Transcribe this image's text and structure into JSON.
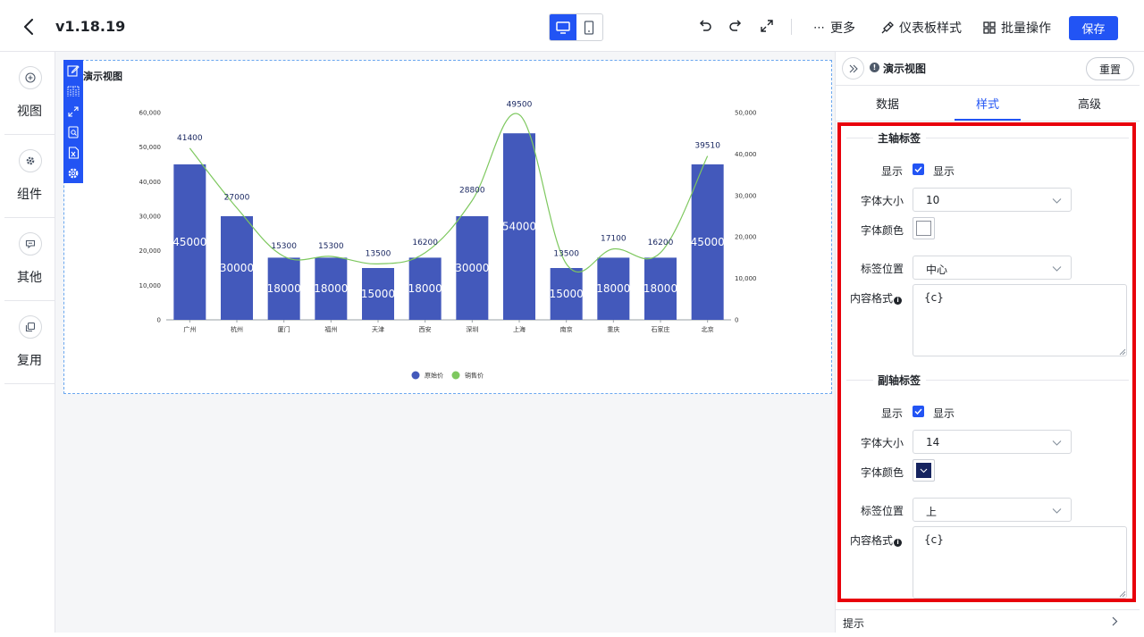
{
  "header": {
    "title": "v1.18.19",
    "more_label": "更多",
    "dashboard_style_label": "仪表板样式",
    "batch_label": "批量操作",
    "save_label": "保存"
  },
  "sidebar": {
    "items": [
      {
        "label": "视图",
        "icon": "plus-circle-icon"
      },
      {
        "label": "组件",
        "icon": "gear-icon"
      },
      {
        "label": "其他",
        "icon": "message-icon"
      },
      {
        "label": "复用",
        "icon": "copy-icon"
      }
    ]
  },
  "chart_card": {
    "title": "演示视图"
  },
  "chart_data": {
    "type": "bar",
    "categories": [
      "广州",
      "杭州",
      "厦门",
      "福州",
      "天津",
      "西安",
      "深圳",
      "上海",
      "南京",
      "重庆",
      "石家庄",
      "北京"
    ],
    "series": [
      {
        "name": "原始价",
        "type": "bar",
        "axis": "left",
        "color": "#4359bb",
        "values": [
          45000,
          30000,
          18000,
          18000,
          15000,
          18000,
          30000,
          54000,
          15000,
          18000,
          18000,
          45000
        ]
      },
      {
        "name": "销售价",
        "type": "line",
        "axis": "right",
        "color": "#7ec85f",
        "values": [
          41400,
          27000,
          15300,
          15300,
          13500,
          16200,
          28800,
          49500,
          13500,
          17100,
          16200,
          39510
        ]
      }
    ],
    "y_left": {
      "min": 0,
      "max": 60000,
      "ticks": [
        "0",
        "10,000",
        "20,000",
        "30,000",
        "40,000",
        "50,000",
        "60,000"
      ]
    },
    "y_right": {
      "min": 0,
      "max": 50000,
      "ticks": [
        "0",
        "10,000",
        "20,000",
        "30,000",
        "40,000",
        "50,000"
      ]
    },
    "legend_position": "bottom-center",
    "grid": false
  },
  "panel": {
    "title": "演示视图",
    "reset_label": "重置",
    "tabs": [
      {
        "label": "数据",
        "active": false
      },
      {
        "label": "样式",
        "active": true
      },
      {
        "label": "高级",
        "active": false
      }
    ],
    "primary": {
      "heading": "主轴标签",
      "show_label": "显示",
      "show_checkbox_label": "显示",
      "show_checked": true,
      "font_size_label": "字体大小",
      "font_size": "10",
      "font_color_label": "字体颜色",
      "font_color": "#ffffff",
      "position_label": "标签位置",
      "position": "中心",
      "format_label": "内容格式",
      "format": "{c}"
    },
    "secondary": {
      "heading": "副轴标签",
      "show_label": "显示",
      "show_checkbox_label": "显示",
      "show_checked": true,
      "font_size_label": "字体大小",
      "font_size": "14",
      "font_color_label": "字体颜色",
      "font_color": "#16245f",
      "position_label": "标签位置",
      "position": "上",
      "format_label": "内容格式",
      "format": "{c}"
    },
    "hint_label": "提示"
  }
}
